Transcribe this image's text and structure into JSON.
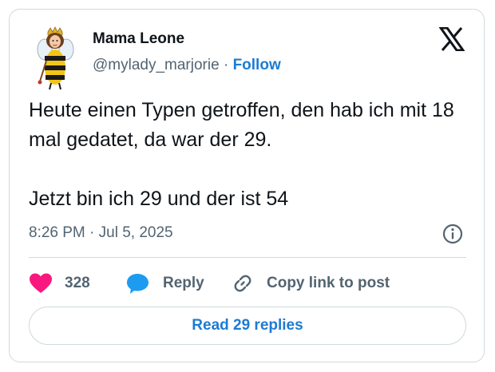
{
  "author": {
    "name": "Mama Leone",
    "handle": "@mylady_marjorie",
    "separator": "·",
    "follow_label": "Follow"
  },
  "tweet": {
    "lines": [
      "Heute einen Typen getroffen, den hab ich mit 18 mal gedatet, da war der 29.",
      "Jetzt bin ich 29 und der ist 54"
    ],
    "timestamp": "8:26 PM · Jul 5, 2025"
  },
  "actions": {
    "like_count": "328",
    "reply_label": "Reply",
    "copy_label": "Copy link to post"
  },
  "footer": {
    "read_replies_label": "Read 29 replies"
  },
  "icons": {
    "brand": "x-logo-icon",
    "info": "info-icon",
    "like": "heart-icon",
    "reply": "speech-bubble-icon",
    "copy": "link-icon"
  },
  "colors": {
    "text": "#0f1419",
    "secondary": "#536471",
    "link": "#1d7bd3",
    "like": "#f91880",
    "reply": "#1d9bf0",
    "border": "#cfd9de"
  }
}
